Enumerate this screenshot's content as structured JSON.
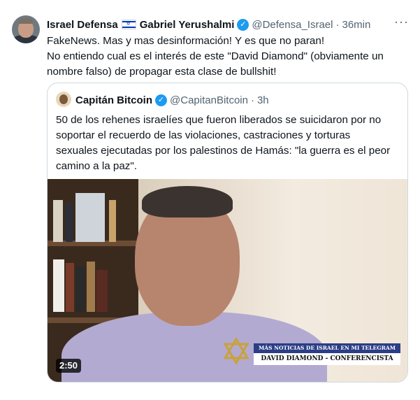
{
  "tweet": {
    "author_name": "Israel Defensa",
    "author_flag": "israel-flag",
    "author_name_2": "Gabriel Yerushalmi",
    "handle": "@Defensa_Israel",
    "separator": "·",
    "time": "36min",
    "more_icon": "···",
    "text_lines": [
      "FakeNews. Mas y mas desinformación! Y es que no paran!",
      "No entiendo cual es el interés de este \"David Diamond\" (obviamente un",
      "nombre falso) de propagar esta clase de bullshit!"
    ]
  },
  "quote": {
    "author_name": "Capitán Bitcoin",
    "handle": "@CapitanBitcoin",
    "separator": "·",
    "time": "3h",
    "text_lines": [
      "50 de los rehenes israelíes que fueron liberados se suicidaron por no",
      "soportar el recuerdo de las violaciones, castraciones y torturas",
      "sexuales ejecutadas por los palestinos de Hamás: \"la guerra es el peor",
      "camino a la paz\"."
    ],
    "video": {
      "banner_top": "MÁS NOTICIAS DE ISRAEL EN MI TELEGRAM",
      "banner_bottom": "DAVID DIAMOND - CONFERENCISTA",
      "duration": "2:50"
    }
  },
  "colors": {
    "verified": "#1d9bf0",
    "secondary_text": "#536471",
    "border": "#cfd9de"
  }
}
